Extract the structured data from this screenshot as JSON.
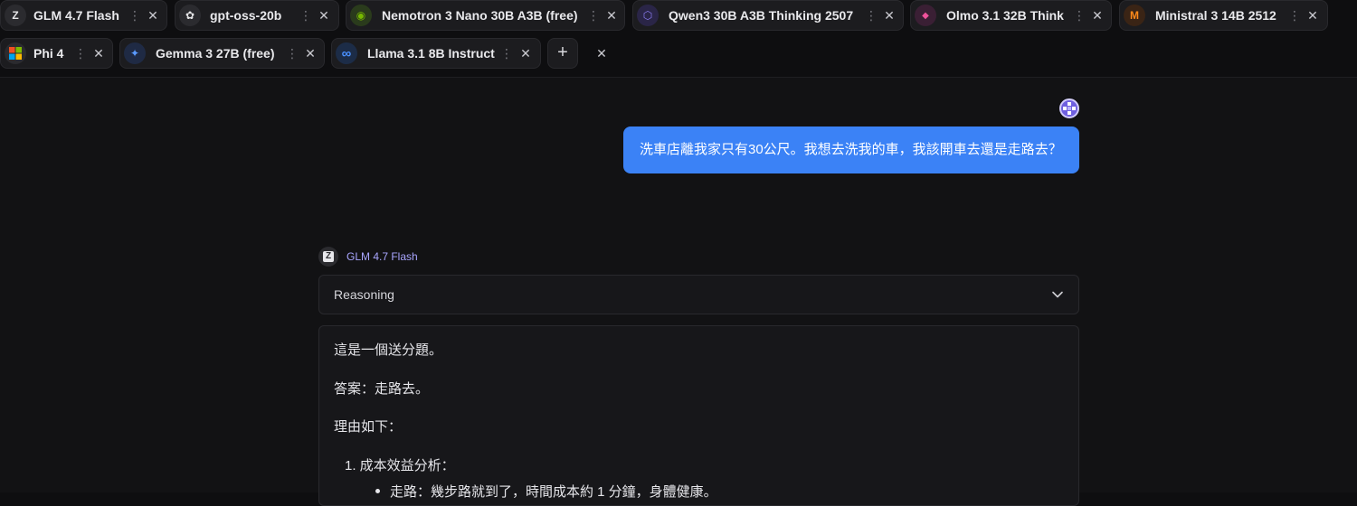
{
  "tabs": [
    {
      "label": "GLM 4.7 Flash",
      "icon": "zhipu-z-logo-icon",
      "glyph": "Z",
      "color": "#2b2b2f"
    },
    {
      "label": "gpt-oss-20b",
      "icon": "openai-knot-logo-icon",
      "glyph": "✿",
      "color": "#2b2b2f"
    },
    {
      "label": "Nemotron 3 Nano 30B A3B (free)",
      "icon": "nvidia-eye-logo-icon",
      "glyph": "◉",
      "color": "#2a3b1c"
    },
    {
      "label": "Qwen3 30B A3B Thinking 2507",
      "icon": "qwen-hex-logo-icon",
      "glyph": "⬡",
      "color": "#2a2547"
    },
    {
      "label": "Olmo 3.1 32B Think",
      "icon": "olmo-diamond-logo-icon",
      "glyph": "◆",
      "color": "#3a1f34"
    },
    {
      "label": "Ministral 3 14B 2512",
      "icon": "mistral-m-logo-icon",
      "glyph": "M",
      "color": "#3a2415"
    },
    {
      "label": "Phi 4",
      "icon": "microsoft-windows-logo-icon",
      "glyph": "▦",
      "color": "#2b2b2f"
    },
    {
      "label": "Gemma 3 27B (free)",
      "icon": "gemma-sparkle-logo-icon",
      "glyph": "✦",
      "color": "#1f2a44"
    },
    {
      "label": "Llama 3.1 8B Instruct",
      "icon": "meta-infinity-logo-icon",
      "glyph": "∞",
      "color": "#1c2c47"
    }
  ],
  "tab_controls": {
    "more_glyph": "⋮",
    "close_glyph": "✕",
    "add_glyph": "+",
    "close_all_glyph": "✕"
  },
  "user_message": {
    "text": "洗車店離我家只有30公尺。我想去洗我的車，我該開車去還是走路去？"
  },
  "response": {
    "model": "GLM 4.7 Flash",
    "model_glyph": "Z",
    "reasoning_label": "Reasoning",
    "paragraphs": [
      "這是一個送分題。",
      "答案：走路去。",
      "理由如下："
    ],
    "list_item_1": "1. 成本效益分析：",
    "sub_item_1": "走路：幾步路就到了，時間成本約 1 分鐘，身體健康。"
  },
  "colors": {
    "accent_blue": "#3b82f6",
    "model_name": "#a9a6ff",
    "background": "#121214"
  }
}
